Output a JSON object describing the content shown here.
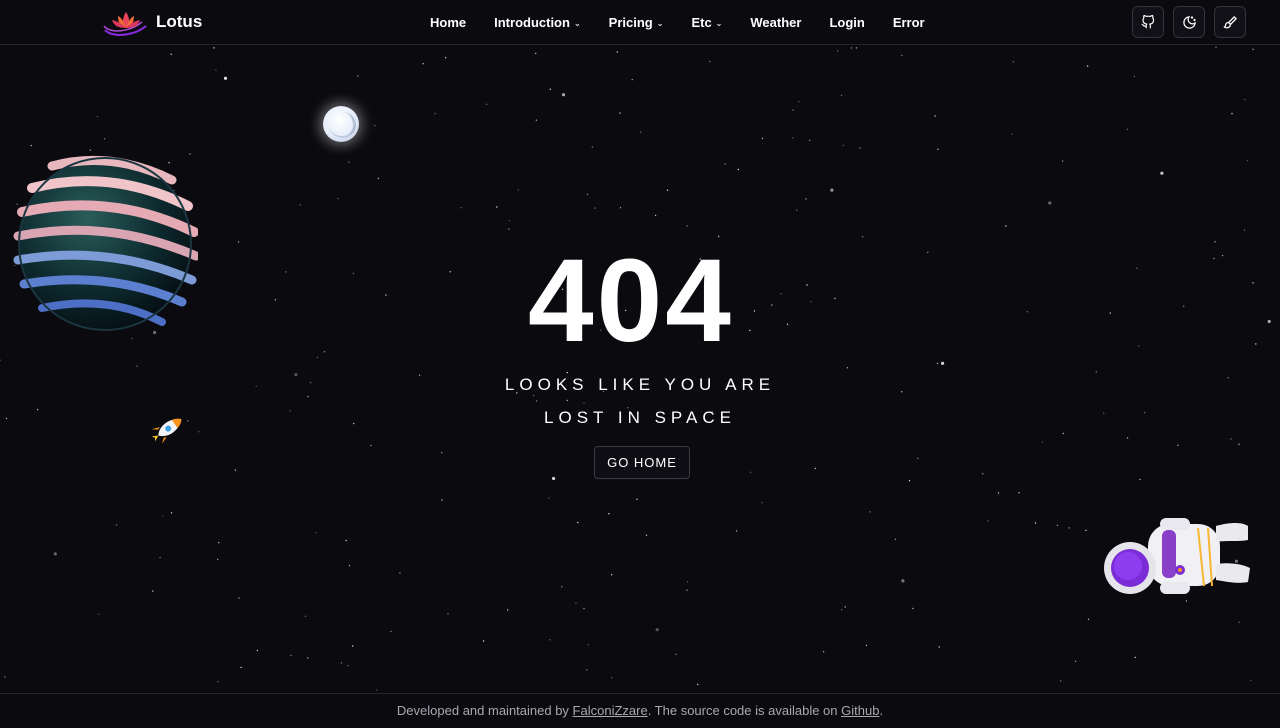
{
  "brand": {
    "name": "Lotus",
    "logo_icon": "lotus-flower-icon"
  },
  "nav": {
    "home": "Home",
    "introduction": "Introduction",
    "pricing": "Pricing",
    "etc": "Etc",
    "weather": "Weather",
    "login": "Login",
    "error": "Error"
  },
  "icons": {
    "github": "github-icon",
    "theme": "moon-icon",
    "customize": "paintbrush-icon"
  },
  "error": {
    "code": "404",
    "line1": "LOOKS LIKE YOU ARE",
    "line2": "LOST IN SPACE",
    "button": "GO HOME"
  },
  "footer": {
    "text1": "Developed and maintained by ",
    "author": "FalconiZzare",
    "text2": ". The source code is available on ",
    "repo": "Github",
    "text3": "."
  },
  "colors": {
    "background": "#0b0a0f",
    "accent_purple": "#8a2be2",
    "text": "#ffffff",
    "muted_text": "#a8a8b0"
  }
}
